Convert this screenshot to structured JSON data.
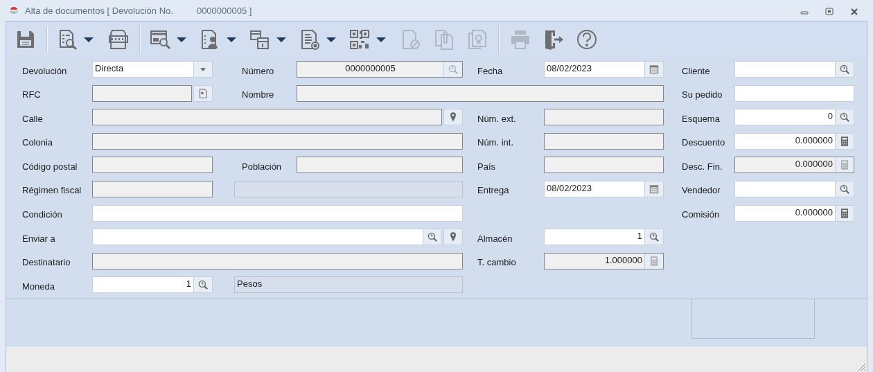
{
  "window": {
    "title": "Alta de documentos [ Devolución No.",
    "title_number": "0000000005 ]"
  },
  "toolbar": [
    {
      "kind": "button",
      "disabled": false,
      "menu": false
    },
    {
      "kind": "separator"
    },
    {
      "kind": "button",
      "disabled": false,
      "menu": true
    },
    {
      "kind": "button",
      "disabled": false,
      "menu": false
    },
    {
      "kind": "separator"
    },
    {
      "kind": "button",
      "disabled": false,
      "menu": true
    },
    {
      "kind": "button",
      "disabled": false,
      "menu": true
    },
    {
      "kind": "button",
      "disabled": false,
      "menu": true
    },
    {
      "kind": "button",
      "disabled": false,
      "menu": true
    },
    {
      "kind": "button",
      "disabled": false,
      "menu": true
    },
    {
      "kind": "button",
      "disabled": true,
      "menu": false
    },
    {
      "kind": "button",
      "disabled": true,
      "menu": false
    },
    {
      "kind": "button",
      "disabled": true,
      "menu": false
    },
    {
      "kind": "separator"
    },
    {
      "kind": "button",
      "disabled": true,
      "menu": false
    },
    {
      "kind": "button",
      "disabled": false,
      "menu": false
    },
    {
      "kind": "button",
      "disabled": false,
      "menu": false
    }
  ],
  "rows": [
    {
      "fields": [
        {
          "label": "Devolución",
          "value": "Directa",
          "kind": "dropdown",
          "disabled": false,
          "wide": false
        },
        {
          "label": "Número",
          "value": "0000000005",
          "kind": "code",
          "disabled": true,
          "wide": false
        },
        {
          "label": "Fecha",
          "value": "08/02/2023",
          "kind": "date",
          "disabled": false,
          "wide": false
        }
      ]
    },
    {
      "fields": [
        {
          "label": "RFC",
          "kind": "document",
          "disabled": true,
          "wide": false
        },
        {
          "label": "Nombre",
          "kind": "text",
          "disabled": true,
          "wide": true
        }
      ]
    },
    {
      "fields": [
        {
          "label": "Calle",
          "kind": "location",
          "disabled": true,
          "wide": true
        },
        {
          "label": "Núm. ext.",
          "kind": "text",
          "disabled": true,
          "wide": false
        }
      ]
    },
    {
      "fields": [
        {
          "label": "Colonia",
          "kind": "text",
          "disabled": true,
          "wide": true
        },
        {
          "label": "Núm. int.",
          "kind": "text",
          "disabled": true,
          "wide": false
        }
      ]
    },
    {
      "fields": [
        {
          "label": "Código postal",
          "kind": "text",
          "disabled": true,
          "wide": false
        },
        {
          "label": "Población",
          "kind": "text",
          "disabled": true,
          "wide": false
        },
        {
          "label": "País",
          "kind": "text",
          "disabled": true,
          "wide": false
        }
      ]
    },
    {
      "fields": [
        {
          "label": "Régimen fiscal",
          "kind": "text",
          "disabled": true,
          "wide": false
        },
        {
          "kind": "display",
          "disabled": true,
          "wide": false
        },
        {
          "label": "Entrega",
          "value": "08/02/2023",
          "kind": "date",
          "disabled": false,
          "wide": false
        }
      ]
    },
    {
      "fields": [
        {
          "label": "Condición",
          "kind": "text",
          "disabled": false,
          "wide": true
        }
      ]
    },
    {
      "fields": [
        {
          "label": "Enviar a",
          "kind": "lookup-location",
          "disabled": false,
          "wide": true
        },
        {
          "label": "Almacén",
          "value": "1",
          "kind": "number",
          "disabled": false,
          "wide": false
        }
      ]
    },
    {
      "fields": [
        {
          "label": "Destinatario",
          "kind": "text",
          "disabled": true,
          "wide": true
        },
        {
          "label": "T. cambio",
          "value": "1.000000",
          "kind": "calculator",
          "disabled": true,
          "wide": false
        }
      ]
    },
    {
      "fields": [
        {
          "label": "Moneda",
          "value": "1",
          "kind": "number",
          "disabled": false,
          "wide": false
        },
        {
          "value": "Pesos",
          "kind": "display",
          "disabled": true,
          "wide": false
        }
      ]
    }
  ],
  "right_fields": [
    {
      "label": "Cliente",
      "kind": "lookup",
      "disabled": false
    },
    {
      "label": "Su pedido",
      "kind": "text",
      "disabled": false
    },
    {
      "label": "Esquema",
      "value": "0",
      "kind": "number",
      "disabled": false
    },
    {
      "label": "Descuento",
      "value": "0.000000",
      "kind": "calculator",
      "disabled": false
    },
    {
      "label": "Desc. Fin.",
      "value": "0.000000",
      "kind": "calculator",
      "disabled": true
    },
    {
      "label": "Vendedor",
      "kind": "lookup",
      "disabled": false
    },
    {
      "label": "Comisión",
      "value": "0.000000",
      "kind": "calculator",
      "disabled": false
    }
  ]
}
